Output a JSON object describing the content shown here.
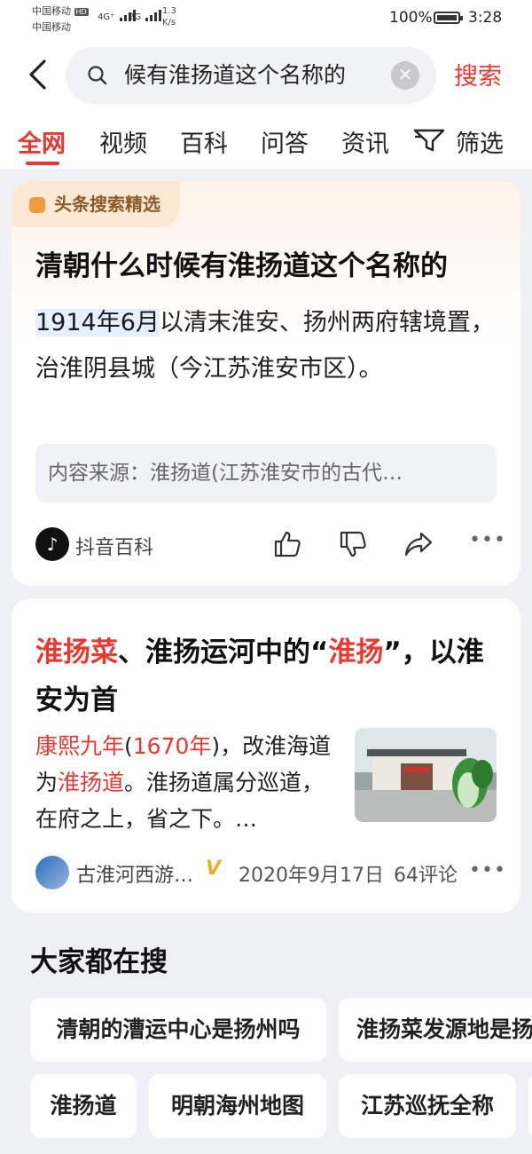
{
  "status_bar": {
    "carrier1": "中国移动",
    "hd": "HD",
    "carrier2": "中国移动",
    "signal1": "4G⁺",
    "signal2": "2G",
    "speed_value": "1.3",
    "speed_unit": "K/s",
    "battery": "100%",
    "battery_level": 1.0,
    "time": "3:28"
  },
  "search": {
    "query": "候有淮扬道这个名称的",
    "clear_icon": "close-icon",
    "button_label": "搜索"
  },
  "tabs": [
    "全网",
    "视频",
    "百科",
    "问答",
    "资讯"
  ],
  "active_tab": "全网",
  "filter_label": "筛选",
  "card1": {
    "badge": "头条搜索精选",
    "title": "清朝什么时候有淮扬道这个名称的",
    "answer_highlight": "1914年6月",
    "answer_rest": "以清末淮安、扬州两府辖境置，治淮阴县城（今江苏淮安市区）。",
    "source": "内容来源：淮扬道(江苏淮安市的古代…",
    "source_name": "抖音百科"
  },
  "card2": {
    "title_part1": "淮扬菜",
    "title_part2": "、淮扬运河中的“",
    "title_part3": "淮扬",
    "title_part4": "”，以淮安为首",
    "desc_part1": "康熙九年",
    "desc_part2": "(",
    "desc_part3": "1670年",
    "desc_part4": ")，改淮海道为",
    "desc_part5": "淮扬道",
    "desc_part6": "。淮扬道属分巡道，在府之上，省之下。…",
    "author": "古淮河西游…",
    "verified": "V",
    "date": "2020年9月17日",
    "comments": "64评论"
  },
  "popular": {
    "title": "大家都在搜",
    "items": [
      "清朝的漕运中心是扬州吗",
      "淮扬菜发源地是扬",
      "淮扬道",
      "明朝海州地图",
      "江苏巡抚全称"
    ]
  },
  "colors": {
    "accent": "#e8382f",
    "badge_bg": "#fbe9d4",
    "verified": "#e8b028"
  }
}
